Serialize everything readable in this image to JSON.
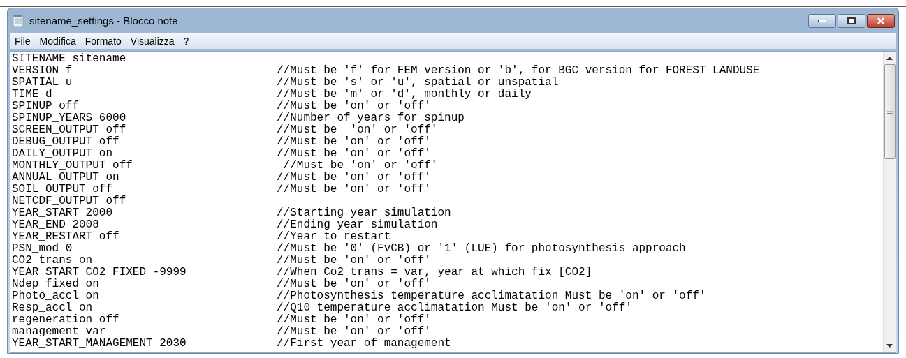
{
  "window": {
    "title": "sitename_settings - Blocco note"
  },
  "menu": [
    "File",
    "Modifica",
    "Formato",
    "Visualizza",
    "?"
  ],
  "lines": [
    {
      "setting": "SITENAME sitename"
    },
    {
      "setting": "VERSION f",
      "comment": "//Must be 'f' for FEM version or 'b', for BGC version for FOREST LANDUSE"
    },
    {
      "setting": "SPATIAL u",
      "comment": "//Must be 's' or 'u', spatial or unspatial"
    },
    {
      "setting": "TIME d",
      "comment": "//Must be 'm' or 'd', monthly or daily"
    },
    {
      "setting": "SPINUP off",
      "comment": "//Must be 'on' or 'off'"
    },
    {
      "setting": "SPINUP_YEARS 6000",
      "comment": "//Number of years for spinup"
    },
    {
      "setting": "SCREEN_OUTPUT off",
      "comment": "//Must be  'on' or 'off'"
    },
    {
      "setting": "DEBUG_OUTPUT off",
      "comment": "//Must be 'on' or 'off'"
    },
    {
      "setting": "DAILY_OUTPUT on",
      "comment": "//Must be 'on' or 'off'"
    },
    {
      "setting": "MONTHLY_OUTPUT off",
      "comment": " //Must be 'on' or 'off'"
    },
    {
      "setting": "ANNUAL_OUTPUT on",
      "comment": "//Must be 'on' or 'off'"
    },
    {
      "setting": "SOIL_OUTPUT off",
      "comment": "//Must be 'on' or 'off'"
    },
    {
      "setting": "NETCDF_OUTPUT off"
    },
    {
      "setting": "YEAR_START 2000",
      "comment": "//Starting year simulation"
    },
    {
      "setting": "YEAR_END 2008",
      "comment": "//Ending year simulation"
    },
    {
      "setting": "YEAR_RESTART off",
      "comment": "//Year to restart"
    },
    {
      "setting": "PSN_mod 0",
      "comment": "//Must be '0' (FvCB) or '1' (LUE) for photosynthesis approach"
    },
    {
      "setting": "CO2_trans on",
      "comment": "//Must be 'on' or 'off'"
    },
    {
      "setting": "YEAR_START_CO2_FIXED -9999",
      "comment": "//When Co2_trans = var, year at which fix [CO2]"
    },
    {
      "setting": "Ndep_fixed on",
      "comment": "//Must be 'on' or 'off'"
    },
    {
      "setting": "Photo_accl on",
      "comment": "//Photosynthesis temperature acclimatation Must be 'on' or 'off'"
    },
    {
      "setting": "Resp_accl on",
      "comment": "//Q10 temperature acclimatation Must be 'on' or 'off'"
    },
    {
      "setting": "regeneration off",
      "comment": "//Must be 'on' or 'off'"
    },
    {
      "setting": "management var",
      "comment": "//Must be 'on' or 'off'"
    },
    {
      "setting": "YEAR_START_MANAGEMENT 2030",
      "comment": "//First year of management"
    }
  ]
}
